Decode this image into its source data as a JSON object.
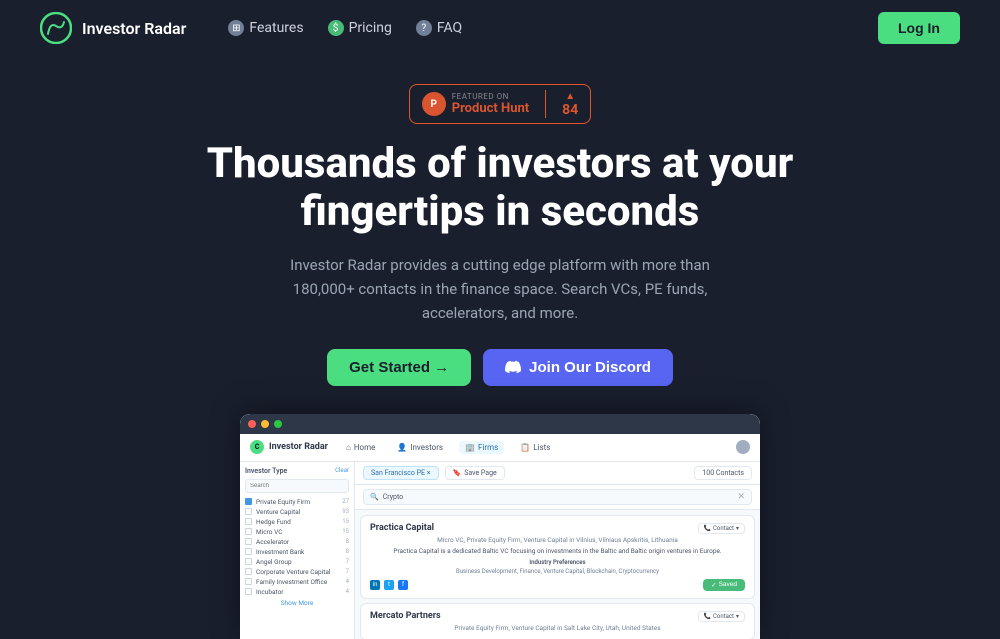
{
  "navbar": {
    "logo_text": "Investor Radar",
    "nav_features_label": "Features",
    "nav_pricing_label": "Pricing",
    "nav_faq_label": "FAQ",
    "login_label": "Log In"
  },
  "hero": {
    "ph_featured": "FEATURED ON",
    "ph_name": "Product Hunt",
    "ph_count": "84",
    "title_line1": "Thousands of investors at your",
    "title_line2": "fingertips in seconds",
    "subtitle": "Investor Radar provides a cutting edge platform with more than 180,000+ contacts in the finance space. Search VCs, PE funds, accelerators, and more.",
    "cta_primary": "Get Started →",
    "cta_discord": "Join Our Discord"
  },
  "app": {
    "title": "Investor Radar",
    "nav_home": "Home",
    "nav_investors": "Investors",
    "nav_firms": "Firms",
    "nav_lists": "Lists",
    "sidebar_title": "Investor Type",
    "sidebar_clear": "Clear",
    "sidebar_search_placeholder": "Search",
    "sidebar_items": [
      {
        "label": "Private Equity Firm",
        "count": "27",
        "checked": true
      },
      {
        "label": "Venture Capital",
        "count": "93",
        "checked": false
      },
      {
        "label": "Hedge Fund",
        "count": "15",
        "checked": false
      },
      {
        "label": "Micro VC",
        "count": "15",
        "checked": false
      },
      {
        "label": "Accelerator",
        "count": "8",
        "checked": false
      },
      {
        "label": "Investment Bank",
        "count": "8",
        "checked": false
      },
      {
        "label": "Angel Group",
        "count": "7",
        "checked": false
      },
      {
        "label": "Corporate Venture Capital",
        "count": "7",
        "checked": false
      },
      {
        "label": "Family Investment Office",
        "count": "4",
        "checked": false
      },
      {
        "label": "Incubator",
        "count": "4",
        "checked": false
      }
    ],
    "show_more": "Show More",
    "filter_chip": "San Francisco PE ×",
    "save_page": "Save Page",
    "contacts_count": "100 Contacts",
    "search_placeholder": "Crypto",
    "card1": {
      "name": "Practica Capital",
      "tags": "Micro VC, Private Equity Firm, Venture Capital in Vilnius, Vilniaus Apskritis, Lithuania",
      "description": "Practica Capital is a dedicated Baltic VC focusing on investments in the Baltic and Baltic origin ventures in Europe.",
      "industry_label": "Industry Preferences",
      "industry_tags": "Business Development, Finance, Venture Capital, Blockchain, Cryptocurrency",
      "saved_label": "Saved",
      "contact_label": "Contact"
    },
    "card2": {
      "name": "Mercato Partners",
      "tags": "Private Equity Firm, Venture Capital in Salt Lake City, Utah, United States",
      "contact_label": "Contact"
    }
  },
  "colors": {
    "bg": "#1a1f2e",
    "accent_green": "#4ade80",
    "accent_blue": "#5865f2",
    "ph_orange": "#da552f"
  }
}
